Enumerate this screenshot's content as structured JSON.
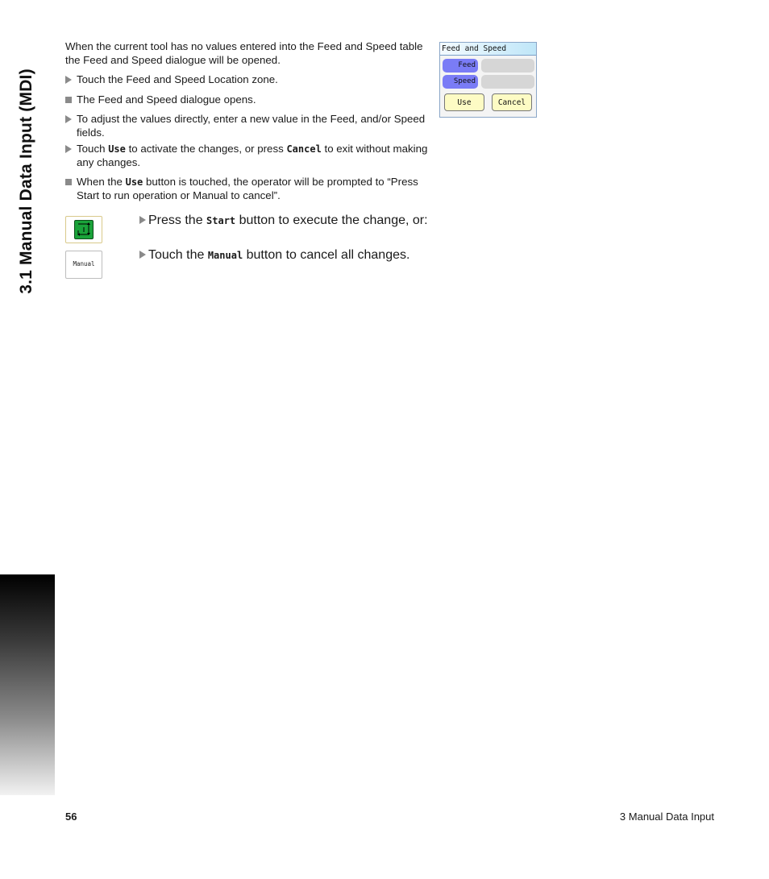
{
  "side_title": "3.1 Manual Data Input (MDI)",
  "intro": "When the current tool has no values entered into the Feed and Speed table the Feed and Speed dialogue will be opened.",
  "steps": [
    {
      "type": "action",
      "text": "Touch the Feed and Speed Location zone."
    },
    {
      "type": "result",
      "text": "The Feed and Speed dialogue opens."
    },
    {
      "type": "action",
      "text": "To adjust the values directly, enter a new value in the Feed, and/or Speed fields."
    }
  ],
  "step_use": {
    "pre": "Touch ",
    "k1": "Use",
    "mid": " to activate the changes, or press ",
    "k2": "Cancel",
    "post": " to exit without making any changes."
  },
  "step_prompt": {
    "pre": "When the ",
    "k1": "Use",
    "post": " button is touched, the operator will be prompted to “Press Start to run operation or Manual to cancel”."
  },
  "start_row": {
    "pre": "Press the ",
    "key": "Start",
    "post": " button to execute the change, or:"
  },
  "manual_row": {
    "pre": "Touch the ",
    "key": "Manual",
    "post": " button to cancel all changes.",
    "button_label": "Manual"
  },
  "dialog": {
    "title": "Feed and Speed",
    "fields": [
      {
        "label": "Feed",
        "value": ""
      },
      {
        "label": "Speed",
        "value": ""
      }
    ],
    "use_label": "Use",
    "cancel_label": "Cancel"
  },
  "footer": {
    "page_number": "56",
    "section": "3 Manual Data Input"
  }
}
